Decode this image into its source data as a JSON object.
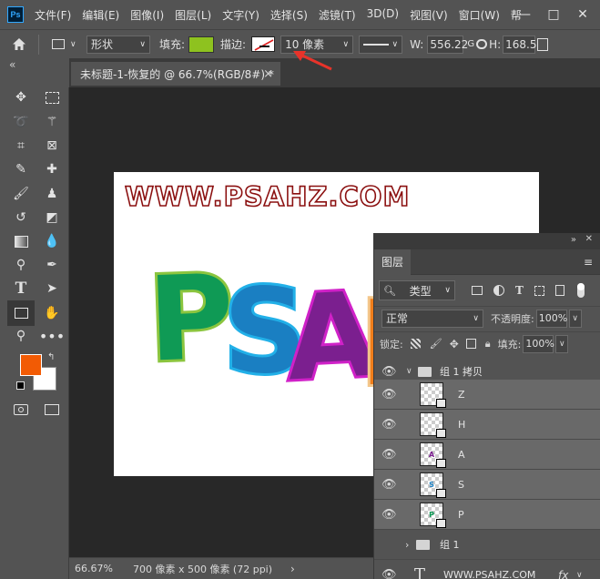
{
  "app_logo": "Ps",
  "menus": [
    "文件(F)",
    "编辑(E)",
    "图像(I)",
    "图层(L)",
    "文字(Y)",
    "选择(S)",
    "滤镜(T)",
    "3D(D)",
    "视图(V)",
    "窗口(W)",
    "帮"
  ],
  "window_controls": {
    "minimize": "—",
    "maximize": "□",
    "close": "✕"
  },
  "options": {
    "shape_mode": "形状",
    "fill_label": "填充:",
    "fill_color": "#8ec21f",
    "stroke_label": "描边:",
    "stroke_width": "10 像素",
    "width_label": "W:",
    "width_value": "556.22",
    "g_label": "G",
    "height_label": "H:",
    "height_value": "168.5"
  },
  "collapse_arrows": "«",
  "doc_tab": {
    "title": "未标题-1-恢复的 @ 66.7%(RGB/8#) *",
    "close": "×"
  },
  "colors": {
    "foreground": "#f25b04",
    "background": "#ffffff",
    "annotation_arrow": "#e8332a"
  },
  "canvas": {
    "url_text": "WWW.PSAHZ.COM",
    "letters": [
      {
        "char": "P",
        "fill": "#0f9a55",
        "stroke": "#8bc53f"
      },
      {
        "char": "S",
        "fill": "#1a7fc2",
        "stroke": "#22b0e8"
      },
      {
        "char": "A",
        "fill": "#7b1f8f",
        "stroke": "#d021c8"
      },
      {
        "char": "H",
        "fill": "#f07d1a",
        "stroke": "#f3c68a"
      }
    ]
  },
  "status": {
    "zoom": "66.67%",
    "doc_info": "700 像素 x 500 像素 (72 ppi)"
  },
  "layers_panel": {
    "title": "图层",
    "filter_label": "类型",
    "blend_mode": "正常",
    "opacity_label": "不透明度:",
    "opacity_value": "100%",
    "lock_label": "锁定:",
    "fill_label": "填充:",
    "fill_value": "100%",
    "layers": [
      {
        "name": "组 1 拷贝",
        "kind": "group",
        "expanded": true
      },
      {
        "name": "Z",
        "kind": "smart",
        "thumb": ""
      },
      {
        "name": "H",
        "kind": "smart",
        "thumb": ""
      },
      {
        "name": "A",
        "kind": "smart",
        "thumb": "A"
      },
      {
        "name": "S",
        "kind": "smart",
        "thumb": "S"
      },
      {
        "name": "P",
        "kind": "smart",
        "thumb": "P"
      },
      {
        "name": "组 1",
        "kind": "group",
        "expanded": false
      },
      {
        "name": "WWW.PSAHZ.COM",
        "kind": "text",
        "fx": "fx"
      }
    ]
  }
}
